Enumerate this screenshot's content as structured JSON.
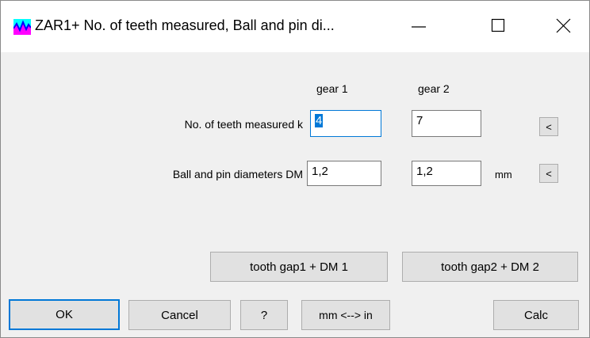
{
  "window": {
    "title": "ZAR1+  No. of teeth measured, Ball and pin di...",
    "icon": "zar1-app-icon",
    "controls": [
      "minimize-icon",
      "maximize-icon",
      "close-icon"
    ]
  },
  "columns": {
    "gear1": "gear 1",
    "gear2": "gear 2"
  },
  "rows": {
    "teeth": {
      "label": "No. of teeth measured k",
      "gear1_value": "4",
      "gear2_value": "7",
      "copy_button": "<"
    },
    "diameter": {
      "label": "Ball and pin diameters DM",
      "gear1_value": "1,2",
      "gear2_value": "1,2",
      "unit": "mm",
      "copy_button": "<"
    }
  },
  "buttons": {
    "tooth_gap1": "tooth gap1 + DM 1",
    "tooth_gap2": "tooth gap2 + DM 2",
    "ok": "OK",
    "cancel": "Cancel",
    "help": "?",
    "units": "mm <--> in",
    "calc": "Calc"
  },
  "colors": {
    "accent": "#0078d7",
    "button_face": "#e1e1e1",
    "dialog_bg": "#f0f0f0"
  }
}
